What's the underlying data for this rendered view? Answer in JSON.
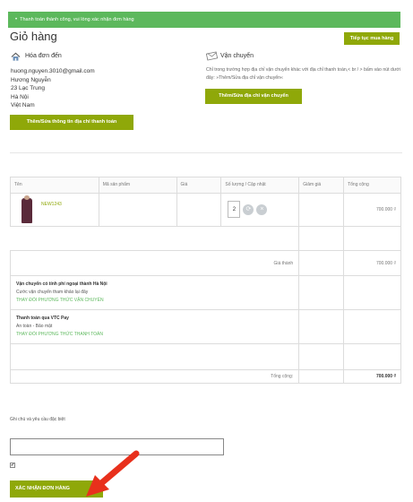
{
  "alert": {
    "message": "Thanh toán thành công, vui lòng xác nhận đơn hàng"
  },
  "page": {
    "title": "Giỏ hàng",
    "continue_label": "Tiếp tục mua hàng"
  },
  "billing": {
    "title": "Hóa đơn đến",
    "lines": [
      "huong.nguyen.3010@gmail.com",
      "Hương  Nguyễn",
      "23 Lạc Trung",
      "Hà Nội",
      "Việt Nam"
    ],
    "button_label": "Thêm/Sửa thông tin địa chỉ thanh toán"
  },
  "shipping": {
    "title": "Vận chuyển",
    "note": "Chỉ trong trường hợp địa chỉ vận chuyển khác với địa chỉ thanh toán,< br / > bấm vào nút dưới đây: »Thêm/Sửa địa chỉ vận chuyển«",
    "button_label": "Thêm/Sửa địa chỉ vận chuyển"
  },
  "cart": {
    "headers": [
      "Tên",
      "Mã sản phẩm",
      "Giá",
      "Số lượng / Cập nhật",
      "Giảm giá",
      "Tổng cộng"
    ],
    "product": {
      "code": "NEW1243",
      "quantity": "2",
      "total": "700.000 ₫"
    },
    "subtotal_label": "Giá thành",
    "subtotal_value": "700.000 ₫",
    "shipping_info": {
      "title": "Vận chuyển có tính phí ngoại thành Hà Nội",
      "desc": "Cước vận chuyển tham khảo lại đây",
      "link": "THAY ĐỔI PHƯƠNG THỨC VẬN CHUYỂN"
    },
    "payment_info": {
      "title": "Thanh toán qua VTC Pay",
      "desc": "An toàn - Bảo mật",
      "link": "THAY ĐỔI PHƯƠNG THỨC THANH TOÁN"
    },
    "total_label": "Tổng cộng:",
    "total_value": "700.000 ₫"
  },
  "footer": {
    "note_label": "Ghi chú và yêu cầu đặc biệt",
    "note_value": "",
    "checkbox_mark": "✔",
    "confirm_label": "XÁC NHẬN ĐƠN HÀNG"
  },
  "colors": {
    "alert": "#5cb85c",
    "button": "#8fa809",
    "arrow": "#e8301c"
  },
  "icons": {
    "billing": "house-icon",
    "shipping": "envelope-icon",
    "update": "refresh-icon",
    "remove": "close-icon"
  }
}
